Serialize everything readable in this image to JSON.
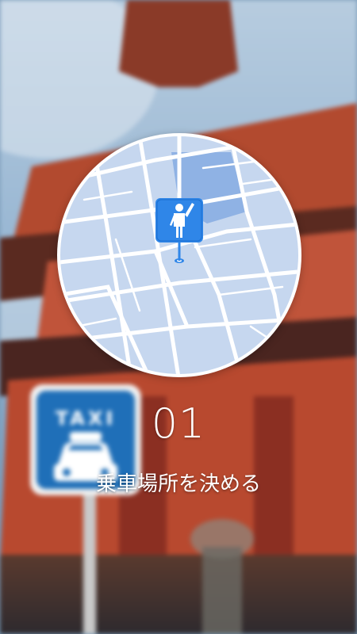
{
  "onboarding": {
    "step_number": "01",
    "step_caption": "乗車場所を決める"
  },
  "background": {
    "sign_text": "TAXI",
    "sign_color": "#1f6fb8",
    "sky_color": "#8fb3d6",
    "pagoda_color": "#a8452e"
  },
  "map": {
    "pin_icon": "person-hailing-icon",
    "pin_color": "#2f86e8",
    "map_bg": "#c6d7ef",
    "road_color": "#ffffff"
  }
}
